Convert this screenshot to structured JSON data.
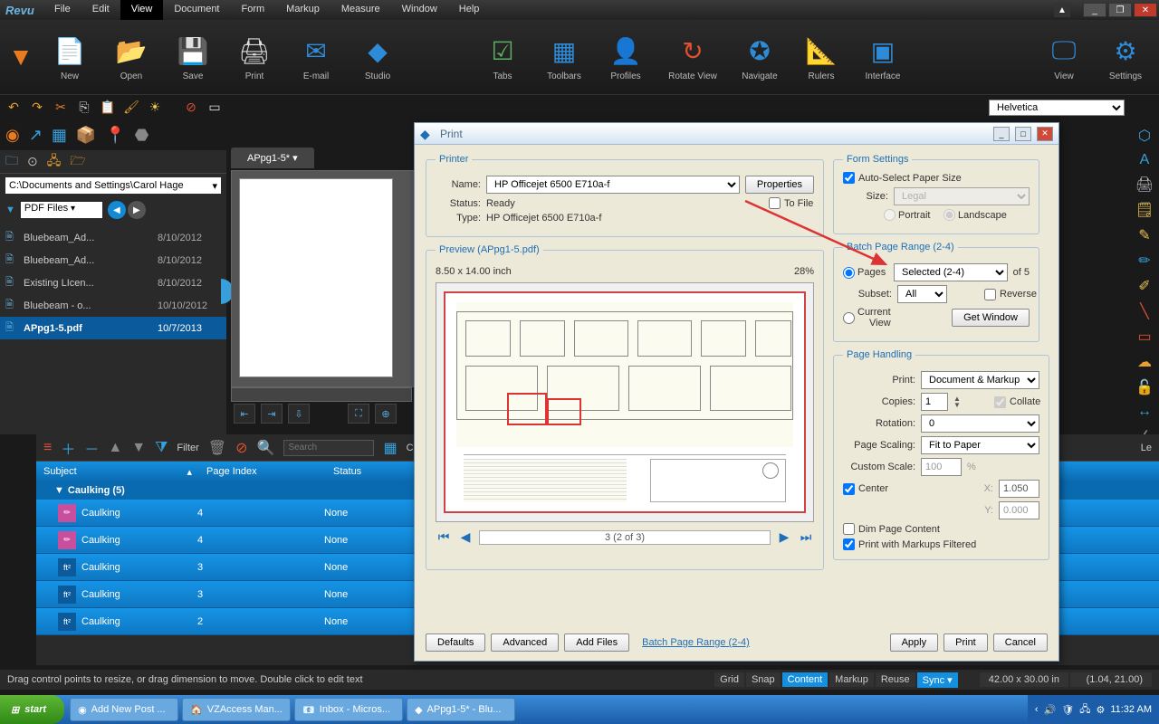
{
  "app": {
    "name": "Revu"
  },
  "menu": [
    "File",
    "Edit",
    "View",
    "Document",
    "Form",
    "Markup",
    "Measure",
    "Window",
    "Help"
  ],
  "menu_active": 2,
  "ribbon": {
    "buttons": [
      {
        "label": "New",
        "icon": "📄",
        "color": "#e8c450"
      },
      {
        "label": "Open",
        "icon": "📂",
        "color": "#e8a030"
      },
      {
        "label": "Save",
        "icon": "💾",
        "color": "#2e8bd8"
      },
      {
        "label": "Print",
        "icon": "🖨",
        "color": "#ddd"
      },
      {
        "label": "E-mail",
        "icon": "✉",
        "color": "#2e8bd8"
      },
      {
        "label": "Studio",
        "icon": "◆",
        "color": "#2e8bd8"
      }
    ],
    "buttons_right": [
      {
        "label": "Tabs",
        "icon": "☑",
        "color": "#2e8bd8"
      },
      {
        "label": "Toolbars",
        "icon": "▦",
        "color": "#2e8bd8"
      },
      {
        "label": "Profiles",
        "icon": "👤",
        "color": "#e8a030"
      },
      {
        "label": "Rotate View",
        "icon": "↻",
        "color": "#e05030"
      },
      {
        "label": "Navigate",
        "icon": "✪",
        "color": "#2e8bd8"
      },
      {
        "label": "Rulers",
        "icon": "📐",
        "color": "#8860c8"
      },
      {
        "label": "Interface",
        "icon": "▣",
        "color": "#2e8bd8"
      }
    ],
    "buttons_far": [
      {
        "label": "View",
        "icon": "🖵",
        "color": "#2e8bd8"
      },
      {
        "label": "Settings",
        "icon": "⚙",
        "color": "#2e8bd8"
      }
    ]
  },
  "font": "Helvetica",
  "left": {
    "path": "C:\\Documents and Settings\\Carol  Hage",
    "filter": "PDF Files",
    "files": [
      {
        "name": "Bluebeam_Ad...",
        "date": "8/10/2012"
      },
      {
        "name": "Bluebeam_Ad...",
        "date": "8/10/2012"
      },
      {
        "name": "Existing LIcen...",
        "date": "8/10/2012"
      },
      {
        "name": "Bluebeam - o...",
        "date": "10/10/2012"
      },
      {
        "name": "APpg1-5.pdf",
        "date": "10/7/2013",
        "selected": true
      }
    ]
  },
  "tabs": {
    "doc": "APpg1-5*"
  },
  "markup": {
    "filter_label": "Filter",
    "search_placeholder": "Search",
    "cols": [
      "Subject",
      "Page Index",
      "Status"
    ],
    "group": "Caulking (5)",
    "rows": [
      {
        "name": "Caulking",
        "page": "4",
        "status": "None",
        "ico": "✏"
      },
      {
        "name": "Caulking",
        "page": "4",
        "status": "None",
        "ico": "✏"
      },
      {
        "name": "Caulking",
        "page": "3",
        "status": "None",
        "ico": "ft²"
      },
      {
        "name": "Caulking",
        "page": "3",
        "status": "None",
        "ico": "ft²"
      },
      {
        "name": "Caulking",
        "page": "2",
        "status": "None",
        "ico": "ft²"
      }
    ]
  },
  "status": {
    "hint": "Drag control points to resize, or drag dimension to move. Double click to edit text",
    "modes": [
      "Grid",
      "Snap",
      "Content",
      "Markup",
      "Reuse",
      "Sync"
    ],
    "modes_active": [
      "Content",
      "Sync"
    ],
    "dim": "42.00 x 30.00 in",
    "coords": "(1.04, 21.00)"
  },
  "taskbar": {
    "start": "start",
    "items": [
      "Add New Post ...",
      "VZAccess Man...",
      "Inbox - Micros...",
      "APpg1-5* - Blu..."
    ],
    "time": "11:32 AM"
  },
  "dialog": {
    "title": "Print",
    "printer": {
      "legend": "Printer",
      "name_label": "Name:",
      "name": "HP Officejet 6500 E710a-f",
      "properties": "Properties",
      "status_label": "Status:",
      "status": "Ready",
      "tofile": "To File",
      "type_label": "Type:",
      "type": "HP Officejet 6500 E710a-f"
    },
    "preview": {
      "legend": "Preview (APpg1-5.pdf)",
      "size": "8.50  x  14.00 inch",
      "zoom": "28%",
      "pager": "3 (2 of 3)"
    },
    "form": {
      "legend": "Form Settings",
      "autosize": "Auto-Select Paper Size",
      "size_label": "Size:",
      "size": "Legal",
      "portrait": "Portrait",
      "landscape": "Landscape"
    },
    "range": {
      "legend": "Batch Page Range (2-4)",
      "pages": "Pages",
      "pages_val": "Selected (2-4)",
      "of": "of 5",
      "subset_label": "Subset:",
      "subset": "All",
      "reverse": "Reverse",
      "current": "Current View",
      "getwindow": "Get Window"
    },
    "handling": {
      "legend": "Page Handling",
      "print_label": "Print:",
      "print": "Document & Markup",
      "copies_label": "Copies:",
      "copies": "1",
      "collate": "Collate",
      "rotation_label": "Rotation:",
      "rotation": "0",
      "scaling_label": "Page Scaling:",
      "scaling": "Fit to Paper",
      "custom_label": "Custom Scale:",
      "custom": "100",
      "pct": "%",
      "center": "Center",
      "x": "X:",
      "xval": "1.050",
      "y": "Y:",
      "yval": "0.000",
      "dim": "Dim Page Content",
      "filtered": "Print with Markups Filtered"
    },
    "buttons": {
      "defaults": "Defaults",
      "advanced": "Advanced",
      "addfiles": "Add Files",
      "link": "Batch Page Range (2-4)",
      "apply": "Apply",
      "print": "Print",
      "cancel": "Cancel"
    }
  }
}
